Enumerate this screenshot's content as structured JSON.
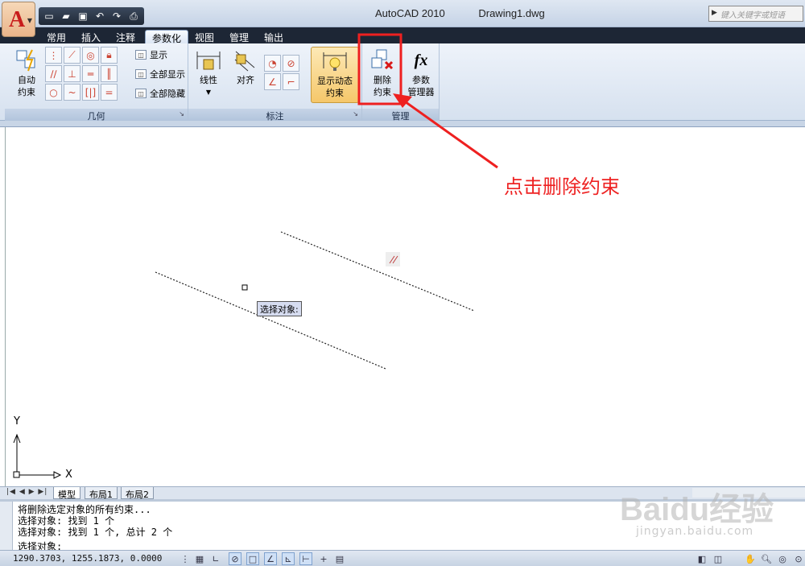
{
  "titlebar": {
    "app_name": "AutoCAD 2010",
    "doc_name": "Drawing1.dwg",
    "search_placeholder": "键入关键字或短语"
  },
  "qat": {
    "icons": [
      "new-icon",
      "open-icon",
      "save-icon",
      "undo-icon",
      "redo-icon",
      "plot-icon"
    ]
  },
  "tabs": [
    {
      "label": "常用"
    },
    {
      "label": "插入"
    },
    {
      "label": "注释"
    },
    {
      "label": "参数化"
    },
    {
      "label": "视图"
    },
    {
      "label": "管理"
    },
    {
      "label": "输出"
    }
  ],
  "active_tab": "参数化",
  "ribbon": {
    "geometry_panel": {
      "title": "几何",
      "auto_constrain": "自动\n约束",
      "show": "显示",
      "show_all": "全部显示",
      "hide_all": "全部隐藏"
    },
    "dimension_panel": {
      "title": "标注",
      "linear": "线性",
      "aligned": "对齐",
      "show_dynamic": "显示动态\n约束"
    },
    "manage_panel": {
      "title": "管理",
      "delete_constraints": "删除\n约束",
      "param_manager": "参数\n管理器",
      "fx": "fx"
    }
  },
  "canvas": {
    "tooltip": "选择对象:",
    "ucs_x": "X",
    "ucs_y": "Y"
  },
  "annotation": {
    "text": "点击删除约束",
    "color": "#e22222"
  },
  "layout_tabs": [
    {
      "label": "模型"
    },
    {
      "label": "布局1"
    },
    {
      "label": "布局2"
    }
  ],
  "command_line": {
    "lines": [
      "将删除选定对象的所有约束...",
      "选择对象: 找到 1 个",
      "选择对象: 找到 1 个, 总计 2 个"
    ],
    "prompt": "选择对象:"
  },
  "status": {
    "coords": "1290.3703, 1255.1873, 0.0000"
  },
  "watermark": {
    "text": "Baidu经验",
    "sub": "jingyan.baidu.com"
  }
}
